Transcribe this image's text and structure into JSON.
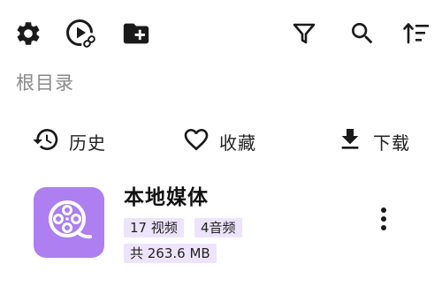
{
  "toolbar": {
    "left_icons": [
      "gear-icon",
      "play-link-icon",
      "folder-add-icon"
    ],
    "right_icons": [
      "filter-icon",
      "search-icon",
      "sort-icon"
    ]
  },
  "breadcrumb": "根目录",
  "quick_links": [
    {
      "icon": "history-icon",
      "label": "历史"
    },
    {
      "icon": "heart-icon",
      "label": "收藏"
    },
    {
      "icon": "download-icon",
      "label": "下载"
    }
  ],
  "media_item": {
    "title": "本地媒体",
    "video_count": "17 视频",
    "audio_count": "4音频",
    "total_size": "共 263.6 MB",
    "thumb_color": "#ad7ff0",
    "icon": "film-reel-icon",
    "more_icon": "more-vertical-icon"
  },
  "colors": {
    "icon": "#1a1a1a",
    "chip_bg": "#ede4fb",
    "accent": "#ad7ff0"
  }
}
